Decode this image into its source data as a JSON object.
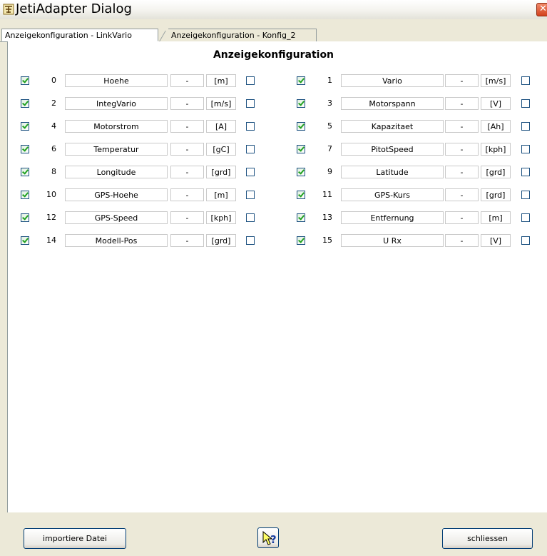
{
  "window": {
    "title": "JetiAdapter Dialog",
    "close_glyph": "✕"
  },
  "tabs": [
    {
      "label": "Anzeigekonfiguration - LinkVario",
      "active": true
    },
    {
      "label": "Anzeigekonfiguration - Konfig_2",
      "active": false
    }
  ],
  "section_title": "Anzeigekonfiguration",
  "rows": [
    {
      "index": "0",
      "name": "Hoehe",
      "value": "-",
      "unit": "[m]",
      "enabled": true,
      "extra": false
    },
    {
      "index": "1",
      "name": "Vario",
      "value": "-",
      "unit": "[m/s]",
      "enabled": true,
      "extra": false
    },
    {
      "index": "2",
      "name": "IntegVario",
      "value": "-",
      "unit": "[m/s]",
      "enabled": true,
      "extra": false
    },
    {
      "index": "3",
      "name": "Motorspann",
      "value": "-",
      "unit": "[V]",
      "enabled": true,
      "extra": false
    },
    {
      "index": "4",
      "name": "Motorstrom",
      "value": "-",
      "unit": "[A]",
      "enabled": true,
      "extra": false
    },
    {
      "index": "5",
      "name": "Kapazitaet",
      "value": "-",
      "unit": "[Ah]",
      "enabled": true,
      "extra": false
    },
    {
      "index": "6",
      "name": "Temperatur",
      "value": "-",
      "unit": "[gC]",
      "enabled": true,
      "extra": false
    },
    {
      "index": "7",
      "name": "PitotSpeed",
      "value": "-",
      "unit": "[kph]",
      "enabled": true,
      "extra": false
    },
    {
      "index": "8",
      "name": "Longitude",
      "value": "-",
      "unit": "[grd]",
      "enabled": true,
      "extra": false
    },
    {
      "index": "9",
      "name": "Latitude",
      "value": "-",
      "unit": "[grd]",
      "enabled": true,
      "extra": false
    },
    {
      "index": "10",
      "name": "GPS-Hoehe",
      "value": "-",
      "unit": "[m]",
      "enabled": true,
      "extra": false
    },
    {
      "index": "11",
      "name": "GPS-Kurs",
      "value": "-",
      "unit": "[grd]",
      "enabled": true,
      "extra": false
    },
    {
      "index": "12",
      "name": "GPS-Speed",
      "value": "-",
      "unit": "[kph]",
      "enabled": true,
      "extra": false
    },
    {
      "index": "13",
      "name": "Entfernung",
      "value": "-",
      "unit": "[m]",
      "enabled": true,
      "extra": false
    },
    {
      "index": "14",
      "name": "Modell-Pos",
      "value": "-",
      "unit": "[grd]",
      "enabled": true,
      "extra": false
    },
    {
      "index": "15",
      "name": "U Rx",
      "value": "-",
      "unit": "[V]",
      "enabled": true,
      "extra": false
    }
  ],
  "footer": {
    "import_label": "importiere Datei",
    "help_icon": "help-pointer-icon",
    "close_label": "schliessen"
  },
  "colors": {
    "check_mark": "#21a121",
    "checkbox_border": "#1c5180",
    "window_bg": "#ece9d8"
  }
}
